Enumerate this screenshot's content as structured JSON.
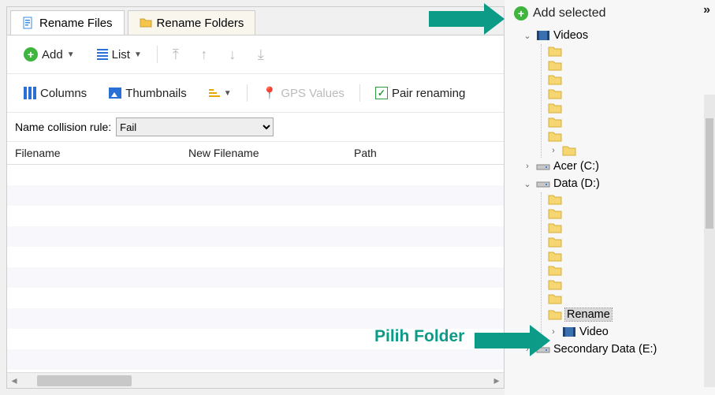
{
  "tabs": {
    "rename_files": "Rename Files",
    "rename_folders": "Rename Folders"
  },
  "toolbar": {
    "add": "Add",
    "list": "List",
    "columns": "Columns",
    "thumbnails": "Thumbnails",
    "gps": "GPS Values",
    "pair": "Pair renaming"
  },
  "collision": {
    "label": "Name collision rule:",
    "value": "Fail"
  },
  "table": {
    "headers": {
      "filename": "Filename",
      "new_filename": "New Filename",
      "path": "Path"
    }
  },
  "right": {
    "add_selected": "Add selected",
    "tree": {
      "videos": "Videos",
      "acer": "Acer (C:)",
      "data": "Data  (D:)",
      "rename": "Rename",
      "video": "Video",
      "secondary": "Secondary Data (E:)"
    }
  },
  "callouts": {
    "pilih": "Pilih Folder"
  }
}
